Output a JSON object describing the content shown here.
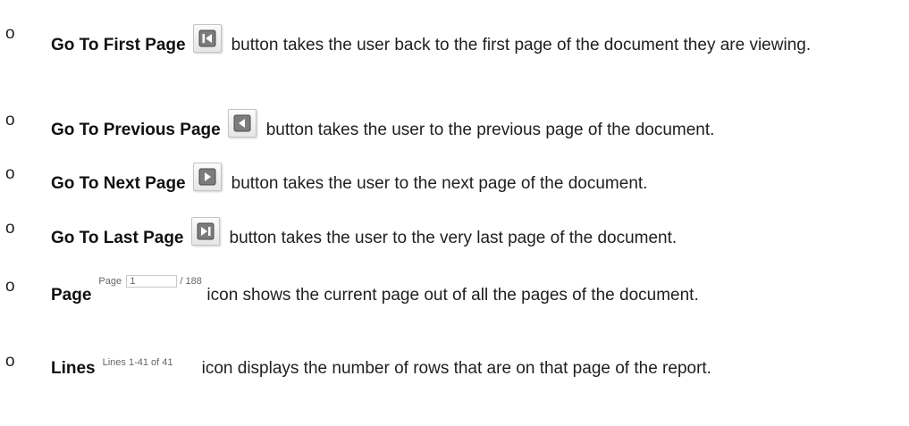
{
  "bullet_marker": "o",
  "items": [
    {
      "term": "Go To First Page",
      "icon": "first-page-icon",
      "text": "button takes the user back to the first page of the document they are viewing."
    },
    {
      "term": "Go To Previous Page",
      "icon": "previous-page-icon",
      "text": "button takes the user to the previous page of the document."
    },
    {
      "term": "Go To Next Page",
      "icon": "next-page-icon",
      "text": "button takes the user to the next page of the document."
    },
    {
      "term": "Go To Last Page",
      "icon": "last-page-icon",
      "text": "button takes the user to the very last page of the document."
    },
    {
      "term": "Page",
      "widget": {
        "label": "Page",
        "value": "1",
        "total": "/ 188"
      },
      "text": "icon shows the current page out of all the pages of the document."
    },
    {
      "term": "Lines",
      "widget": {
        "text": "Lines 1-41 of 41"
      },
      "text": "icon displays the number of rows that are on that page of the report."
    }
  ]
}
